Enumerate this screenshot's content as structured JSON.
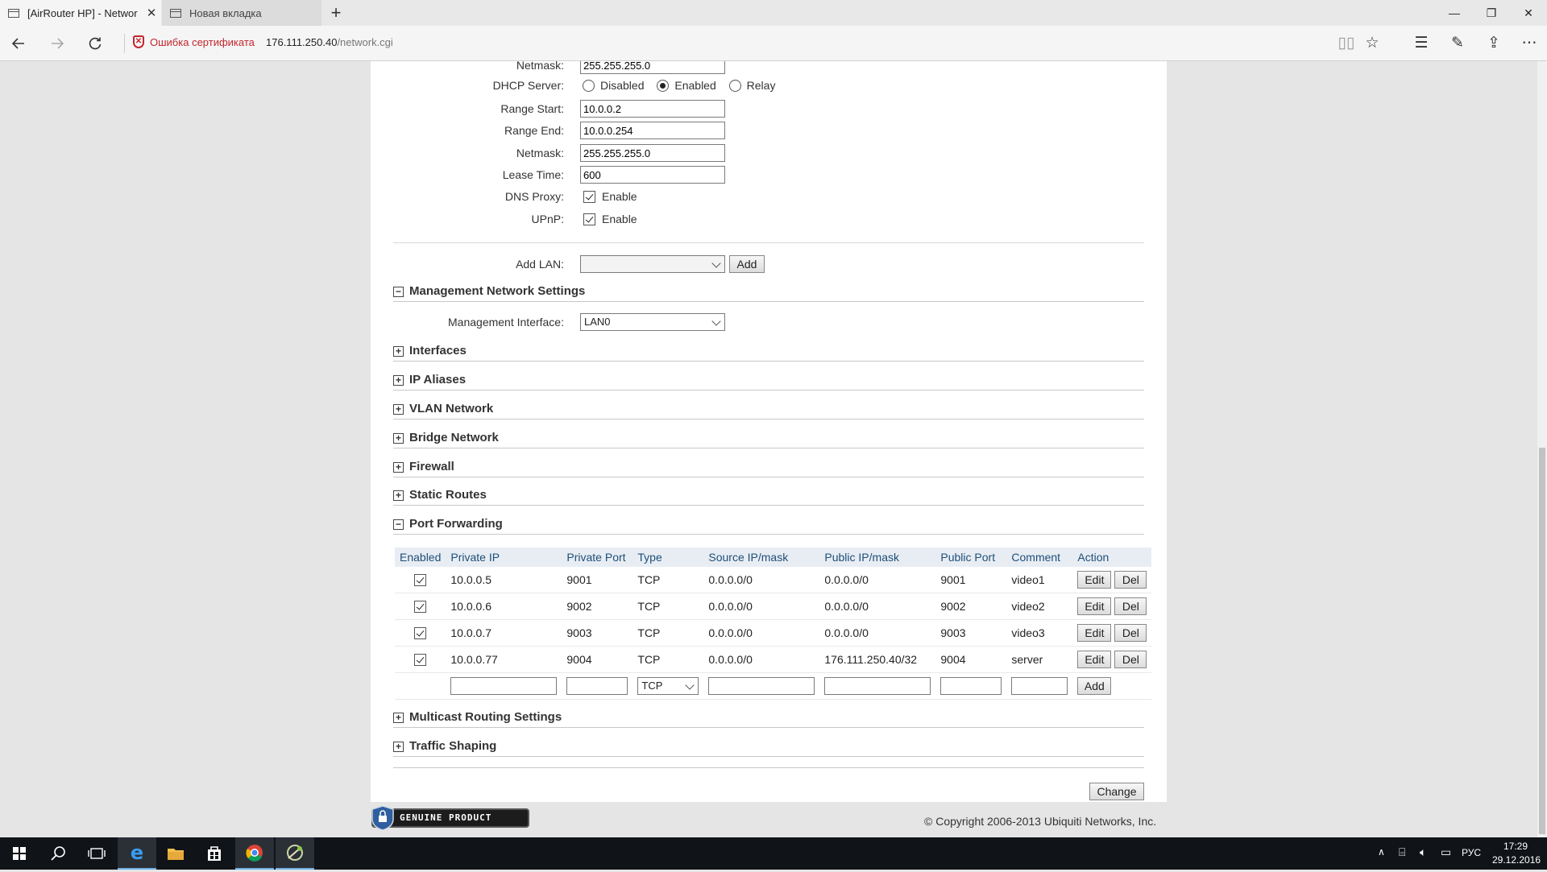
{
  "browser": {
    "tabs": [
      {
        "title": "[AirRouter HP] - Networ",
        "active": true
      },
      {
        "title": "Новая вкладка",
        "active": false
      }
    ],
    "new_tab": "+",
    "cert_warning": "Ошибка сертификата",
    "url_host": "176.111.250.40",
    "url_path": "/network.cgi",
    "window": {
      "minimize": "—",
      "restore": "❐",
      "close": "✕"
    }
  },
  "dhcp": {
    "top_netmask_label": "Netmask:",
    "top_netmask_value": "255.255.255.0",
    "server_label": "DHCP Server:",
    "options": [
      "Disabled",
      "Enabled",
      "Relay"
    ],
    "selected": "Enabled",
    "range_start_label": "Range Start:",
    "range_start": "10.0.0.2",
    "range_end_label": "Range End:",
    "range_end": "10.0.0.254",
    "netmask_label": "Netmask:",
    "netmask": "255.255.255.0",
    "lease_label": "Lease Time:",
    "lease": "600",
    "dns_proxy_label": "DNS Proxy:",
    "dns_proxy_option": "Enable",
    "upnp_label": "UPnP:",
    "upnp_option": "Enable"
  },
  "add_lan": {
    "label": "Add LAN:",
    "value": "",
    "button": "Add"
  },
  "management": {
    "title": "Management Network Settings",
    "interface_label": "Management Interface:",
    "interface_value": "LAN0"
  },
  "sections": {
    "interfaces": "Interfaces",
    "ip_aliases": "IP Aliases",
    "vlan": "VLAN Network",
    "bridge": "Bridge Network",
    "firewall": "Firewall",
    "static_routes": "Static Routes",
    "port_forwarding": "Port Forwarding",
    "multicast": "Multicast Routing Settings",
    "traffic": "Traffic Shaping"
  },
  "toggles": {
    "expanded": "−",
    "collapsed": "+"
  },
  "port_forwarding": {
    "columns": [
      "Enabled",
      "Private IP",
      "Private Port",
      "Type",
      "Source IP/mask",
      "Public IP/mask",
      "Public Port",
      "Comment",
      "Action"
    ],
    "rows": [
      {
        "private_ip": "10.0.0.5",
        "private_port": "9001",
        "type": "TCP",
        "source": "0.0.0.0/0",
        "public_ip": "0.0.0.0/0",
        "public_port": "9001",
        "comment": "video1"
      },
      {
        "private_ip": "10.0.0.6",
        "private_port": "9002",
        "type": "TCP",
        "source": "0.0.0.0/0",
        "public_ip": "0.0.0.0/0",
        "public_port": "9002",
        "comment": "video2"
      },
      {
        "private_ip": "10.0.0.7",
        "private_port": "9003",
        "type": "TCP",
        "source": "0.0.0.0/0",
        "public_ip": "0.0.0.0/0",
        "public_port": "9003",
        "comment": "video3"
      },
      {
        "private_ip": "10.0.0.77",
        "private_port": "9004",
        "type": "TCP",
        "source": "0.0.0.0/0",
        "public_ip": "176.111.250.40/32",
        "public_port": "9004",
        "comment": "server"
      }
    ],
    "edit_label": "Edit",
    "del_label": "Del",
    "new_type": "TCP",
    "add_label": "Add"
  },
  "change_button": "Change",
  "genuine_text": "GENUINE PRODUCT",
  "copyright": "© Copyright 2006-2013 Ubiquiti Networks, Inc.",
  "taskbar": {
    "lang": "РУС",
    "time": "17:29",
    "date": "29.12.2016"
  }
}
